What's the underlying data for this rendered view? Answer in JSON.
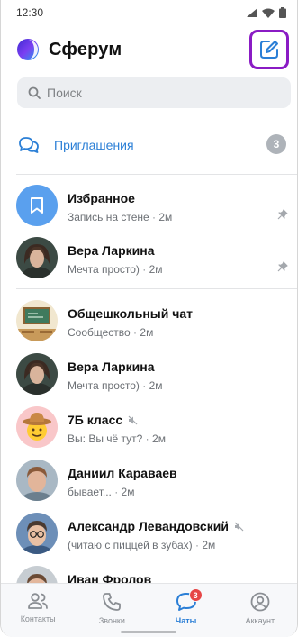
{
  "status_bar": {
    "time": "12:30"
  },
  "header": {
    "app_title": "Сферум"
  },
  "search": {
    "placeholder": "Поиск"
  },
  "invites": {
    "label": "Приглашения",
    "count": "3"
  },
  "chats": [
    {
      "name": "Избранное",
      "preview": "Запись на стене",
      "time": "2м",
      "pinned": true,
      "muted": false,
      "avatar": "bookmark"
    },
    {
      "name": "Вера Ларкина",
      "preview": "Мечта просто)",
      "time": "2м",
      "pinned": true,
      "muted": false,
      "avatar": "photo-woman"
    },
    {
      "name": "Общешкольный чат",
      "preview": "Сообщество",
      "time": "2м",
      "pinned": false,
      "muted": false,
      "avatar": "classroom"
    },
    {
      "name": "Вера Ларкина",
      "preview": "Мечта просто)",
      "time": "2м",
      "pinned": false,
      "muted": false,
      "avatar": "photo-woman"
    },
    {
      "name": "7Б класс",
      "preview_prefix": "Вы:",
      "preview": "Вы чё тут?",
      "time": "2м",
      "pinned": false,
      "muted": true,
      "avatar": "cowboy-emoji"
    },
    {
      "name": "Даниил Караваев",
      "preview": "бывает...",
      "time": "2м",
      "pinned": false,
      "muted": false,
      "avatar": "photo-man"
    },
    {
      "name": "Александр Левандовский",
      "preview": "(читаю с пиццей в зубах)",
      "time": "2м",
      "pinned": false,
      "muted": true,
      "avatar": "photo-man-glasses"
    },
    {
      "name": "Иван Фролов",
      "preview": "",
      "time": "",
      "pinned": false,
      "muted": false,
      "avatar": "photo-man-2"
    }
  ],
  "tabbar": {
    "tabs": [
      {
        "label": "Контакты",
        "icon": "contacts-icon",
        "active": false
      },
      {
        "label": "Звонки",
        "icon": "phone-icon",
        "active": false
      },
      {
        "label": "Чаты",
        "icon": "chat-icon",
        "active": true,
        "badge": "3"
      },
      {
        "label": "Аккаунт",
        "icon": "account-icon",
        "active": false
      }
    ]
  },
  "colors": {
    "accent": "#2b7fd6",
    "highlight": "#8a1bc4",
    "badge": "#e64646"
  }
}
